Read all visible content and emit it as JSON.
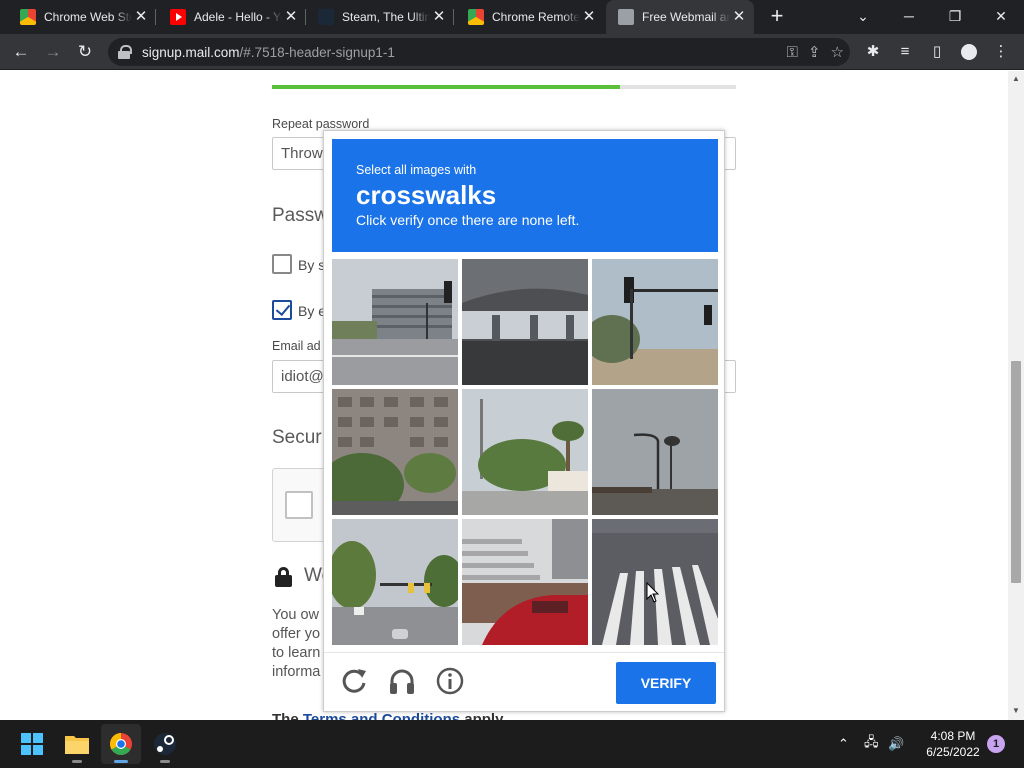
{
  "browser": {
    "tabs": [
      {
        "title": "Chrome Web Store",
        "icon": "chrome-web-store-icon"
      },
      {
        "title": "Adele - Hello - YouTube",
        "icon": "youtube-icon"
      },
      {
        "title": "Steam, The Ultimate",
        "icon": "steam-icon"
      },
      {
        "title": "Chrome Remote Desktop",
        "icon": "chrome-remote-desktop-icon"
      },
      {
        "title": "Free Webmail and",
        "icon": "globe-icon",
        "active": true
      }
    ],
    "url_host": "signup.mail.com",
    "url_path": "/#.7518-header-signup1-1"
  },
  "form": {
    "progress_fraction": 0.75,
    "repeat_password_label": "Repeat password",
    "repeat_password_value": "Throw",
    "password_section_heading": "Passw",
    "checkbox1_label": "By s",
    "checkbox1_checked": false,
    "checkbox2_label": "By e",
    "checkbox2_checked": true,
    "email_label": "Email ad",
    "email_value": "idiot@",
    "security_heading": "Secur",
    "we_heading": "We",
    "paragraph_lines": [
      "You ow",
      "offer yo",
      "to learn",
      "informa"
    ],
    "terms_prefix": "The ",
    "terms_link": "Terms and Conditions",
    "terms_suffix": " apply"
  },
  "challenge": {
    "prefix": "Select all images with",
    "target": "crosswalks",
    "subtitle": "Click verify once there are none left.",
    "verify_label": "VERIFY",
    "tiles": [
      "office-building-street",
      "overpass-underpass",
      "traffic-light-desert",
      "tall-building-palms",
      "palm-trees-street",
      "streetlight-sky",
      "road-traffic-lights",
      "stairs-red-car",
      "crosswalk-stripes"
    ]
  },
  "taskbar": {
    "time": "4:08 PM",
    "date": "6/25/2022",
    "notifications": "1"
  },
  "colors": {
    "challenge_blue": "#1a73e8",
    "progress_green": "#5cbf3a",
    "link_blue": "#1c4b9c"
  }
}
